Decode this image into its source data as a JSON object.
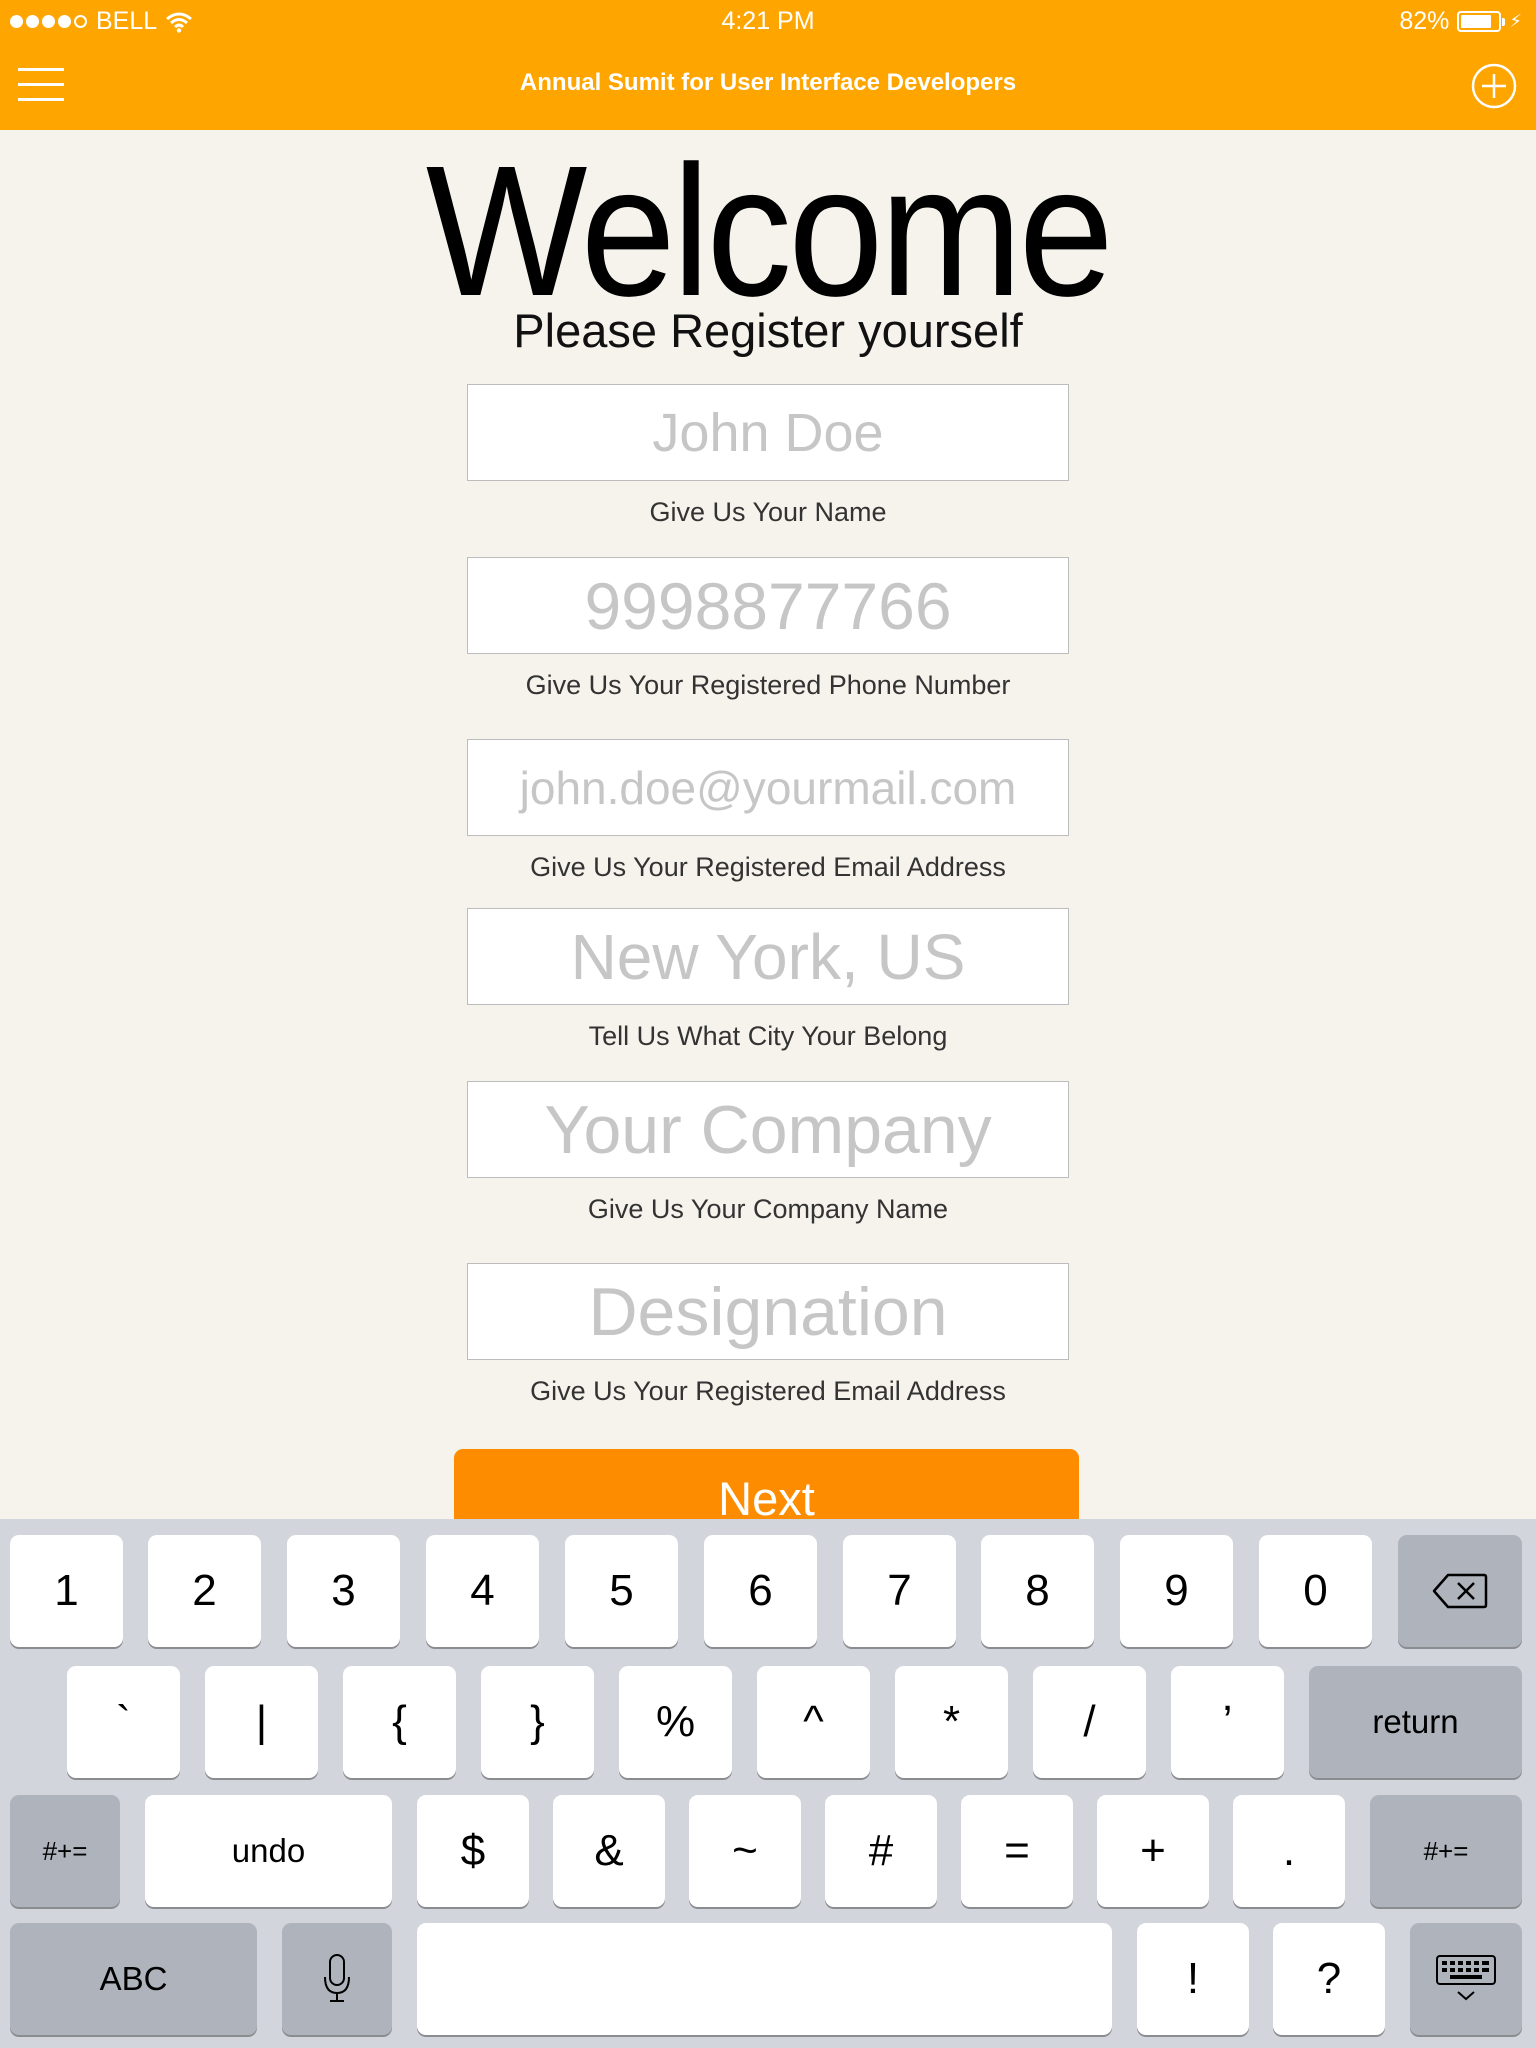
{
  "status_bar": {
    "carrier": "BELL",
    "time": "4:21 PM",
    "battery": "82%",
    "battery_level": 0.82,
    "signal_bars": 4
  },
  "nav": {
    "title": "Annual Sumit for User Interface Developers",
    "menu_icon": "hamburger-menu-icon",
    "add_icon": "plus-circle-icon"
  },
  "header": {
    "welcome": "Welcome",
    "subtitle": "Please Register yourself"
  },
  "form": {
    "name": {
      "placeholder": "John Doe",
      "hint": "Give Us Your Name"
    },
    "phone": {
      "placeholder": "9998877766",
      "hint": "Give Us Your Registered Phone Number"
    },
    "email": {
      "placeholder": "john.doe@yourmail.com",
      "hint": "Give Us Your Registered Email Address"
    },
    "city": {
      "placeholder": "New York, US",
      "hint": "Tell Us What City Your Belong"
    },
    "company": {
      "placeholder": "Your Company",
      "hint": "Give Us Your Company Name"
    },
    "designation": {
      "placeholder": "Designation",
      "hint": "Give Us Your Registered Email Address"
    },
    "next_label": "Next"
  },
  "keyboard": {
    "row1": [
      "1",
      "2",
      "3",
      "4",
      "5",
      "6",
      "7",
      "8",
      "9",
      "0"
    ],
    "row2": [
      "`",
      "|",
      "{",
      "}",
      "%",
      "^",
      "*",
      "/",
      "’"
    ],
    "return_label": "return",
    "row3_left": "#+=",
    "undo_label": "undo",
    "row3": [
      "$",
      "&",
      "~",
      "#",
      "=",
      "+",
      "."
    ],
    "row3_right": "#+=",
    "abc_label": "ABC",
    "row4_right": [
      "!",
      "?"
    ],
    "icons": {
      "backspace": "backspace-icon",
      "microphone": "microphone-icon",
      "dismiss": "keyboard-dismiss-icon"
    }
  }
}
